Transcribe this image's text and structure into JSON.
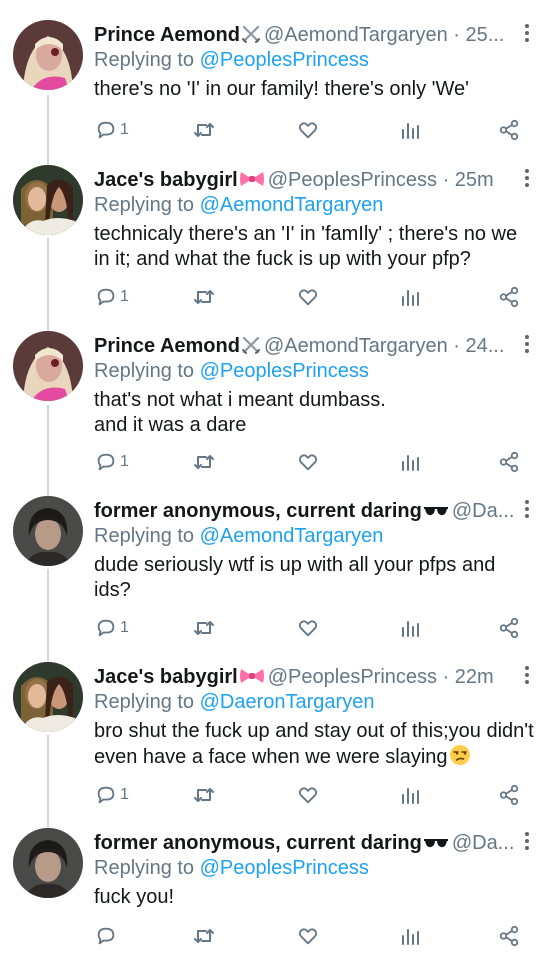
{
  "tweets": [
    {
      "name": "Prince Aemond",
      "name_emoji": "crossed-swords",
      "handle": "@AemondTargaryen",
      "time": "· 25...",
      "reply_label": "Replying to",
      "reply_to": "@PeoplesPrincess",
      "text": "there's no 'I' in our family! there's only 'We'",
      "reply_count": "1",
      "avatar": "aemond"
    },
    {
      "name": "Jace's babygirl",
      "name_emoji": "pink-bow",
      "handle": "@PeoplesPrincess",
      "time": "· 25m",
      "reply_label": "Replying to",
      "reply_to": "@AemondTargaryen",
      "text": "technicaly there's an 'I' in 'famIly' ; there's no we in it; and what the fuck is up with your pfp?",
      "reply_count": "1",
      "avatar": "jace"
    },
    {
      "name": "Prince Aemond",
      "name_emoji": "crossed-swords",
      "handle": "@AemondTargaryen",
      "time": "· 24...",
      "reply_label": "Replying to",
      "reply_to": "@PeoplesPrincess",
      "text": "that's not what i meant dumbass.\nand it was a dare",
      "reply_count": "1",
      "avatar": "aemond"
    },
    {
      "name": "former anonymous, current daring",
      "name_emoji": "sunglasses",
      "handle": "@Da...",
      "time": "",
      "reply_label": "Replying to",
      "reply_to": "@AemondTargaryen",
      "text": "dude seriously wtf is up with all your pfps and ids?",
      "reply_count": "1",
      "avatar": "daeron"
    },
    {
      "name": "Jace's babygirl",
      "name_emoji": "pink-bow",
      "handle": "@PeoplesPrincess",
      "time": "· 22m",
      "reply_label": "Replying to",
      "reply_to": "@DaeronTargaryen",
      "text": "bro shut the fuck up and stay out of this;you didn't even have a face when we were slaying",
      "text_emoji": "unamused-face",
      "reply_count": "1",
      "avatar": "jace"
    },
    {
      "name": "former anonymous, current daring",
      "name_emoji": "sunglasses",
      "handle": "@Da...",
      "time": "",
      "reply_label": "Replying to",
      "reply_to": "@PeoplesPrincess",
      "text": "fuck you!",
      "reply_count": "",
      "avatar": "daeron"
    }
  ],
  "icons": {
    "reply": "reply-icon",
    "retweet": "retweet-icon",
    "like": "like-icon",
    "stats": "analytics-icon",
    "share": "share-icon",
    "more": "more-icon"
  },
  "colors": {
    "name": "#14171a",
    "secondary": "#657786",
    "mention": "#1da1f2",
    "thread_line": "#cfd9de",
    "bow": "#ff6fa8"
  }
}
